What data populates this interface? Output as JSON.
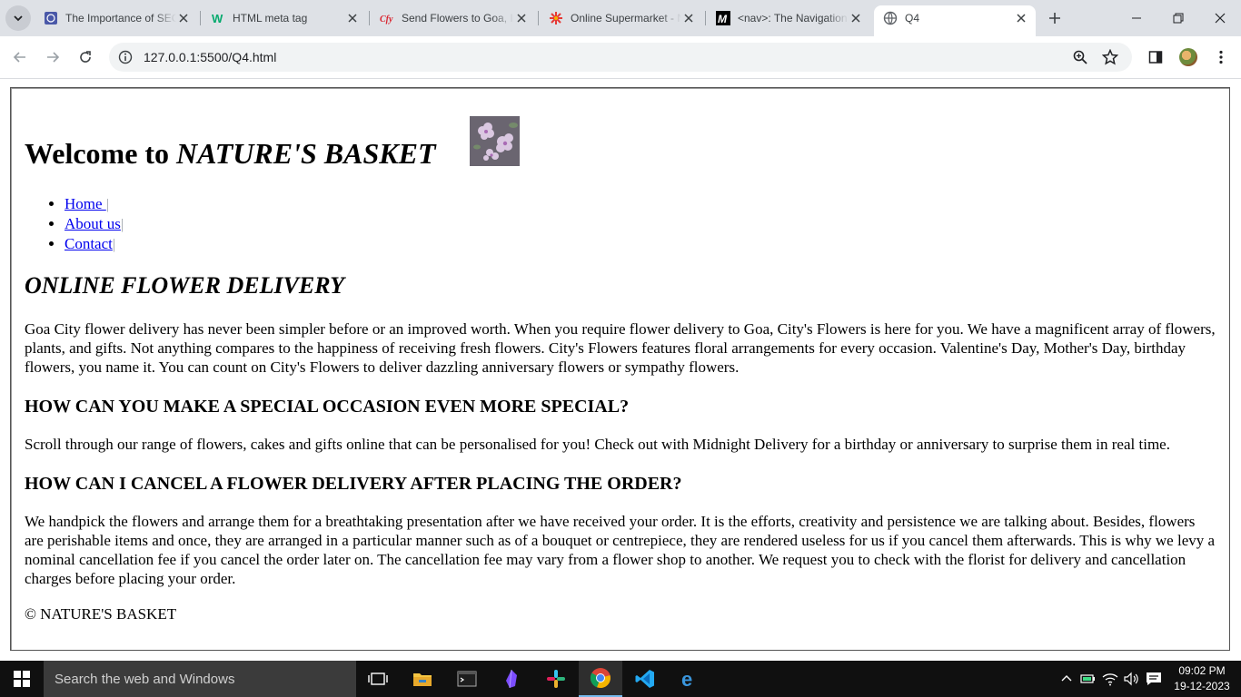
{
  "browser": {
    "tabs": [
      {
        "title": "The Importance of SEO",
        "favicon": "book-icon",
        "color": "#4a58a8"
      },
      {
        "title": "HTML meta tag",
        "favicon": "w3-icon",
        "color": "#04aa6d"
      },
      {
        "title": "Send Flowers to Goa, India",
        "favicon": "city-flowers-icon",
        "color": "#d9232e"
      },
      {
        "title": "Online Supermarket - Nature's Basket",
        "favicon": "starburst-icon",
        "color": "#e53935"
      },
      {
        "title": "<nav>: The Navigation Section element",
        "favicon": "mdn-icon",
        "color": "#000000"
      },
      {
        "title": "Q4",
        "favicon": "globe-icon",
        "color": "#5f6368",
        "active": true
      }
    ],
    "url": "127.0.0.1:5500/Q4.html"
  },
  "page": {
    "welcome_prefix": "Welcome to ",
    "brand": "NATURE'S BASKET",
    "nav": [
      {
        "label": "Home ",
        "sep": "|"
      },
      {
        "label": "About us",
        "sep": "|"
      },
      {
        "label": "Contact",
        "sep": "|"
      }
    ],
    "heading": "ONLINE FLOWER DELIVERY",
    "intro": "Goa City flower delivery has never been simpler before or an improved worth. When you require flower delivery to Goa, City's Flowers is here for you. We have a magnificent array of flowers, plants, and gifts. Not anything compares to the happiness of receiving fresh flowers. City's Flowers features floral arrangements for every occasion. Valentine's Day, Mother's Day, birthday flowers, you name it. You can count on City's Flowers to deliver dazzling anniversary flowers or sympathy flowers.",
    "q1": "HOW CAN YOU MAKE A SPECIAL OCCASION EVEN MORE SPECIAL?",
    "a1": "Scroll through our range of flowers, cakes and gifts online that can be personalised for you! Check out with Midnight Delivery for a birthday or anniversary to surprise them in real time.",
    "q2": "HOW CAN I CANCEL A FLOWER DELIVERY AFTER PLACING THE ORDER?",
    "a2": "We handpick the flowers and arrange them for a breathtaking presentation after we have received your order. It is the efforts, creativity and persistence we are talking about. Besides, flowers are perishable items and once, they are arranged in a particular manner such as of a bouquet or centrepiece, they are rendered useless for us if you cancel them afterwards. This is why we levy a nominal cancellation fee if you cancel the order later on. The cancellation fee may vary from a flower shop to another. We request you to check with the florist for delivery and cancellation charges before placing your order.",
    "footer": "© NATURE'S BASKET"
  },
  "taskbar": {
    "search_placeholder": "Search the web and Windows",
    "time": "09:02 PM",
    "date": "19-12-2023"
  }
}
